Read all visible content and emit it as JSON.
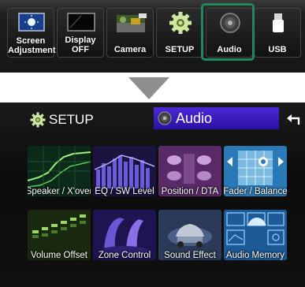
{
  "top_bar": {
    "buttons": [
      {
        "label_line1": "Screen",
        "label_line2": "Adjustment"
      },
      {
        "label": "Display OFF"
      },
      {
        "label": "Camera"
      },
      {
        "label": "SETUP"
      },
      {
        "label": "Audio",
        "highlighted": true
      },
      {
        "label": "USB"
      }
    ],
    "highlight_color": "#1e8a5b"
  },
  "audio_screen": {
    "tabs": {
      "setup": "SETUP",
      "audio": "Audio"
    },
    "active_tab_color": "#3a1dc0",
    "items": [
      {
        "label": "Speaker / X'over"
      },
      {
        "label": "EQ / SW Level"
      },
      {
        "label": "Position / DTA"
      },
      {
        "label": "Fader / Balance"
      },
      {
        "label": "Volume Offset"
      },
      {
        "label": "Zone Control"
      },
      {
        "label": "Sound Effect"
      },
      {
        "label": "Audio Memory"
      }
    ]
  }
}
